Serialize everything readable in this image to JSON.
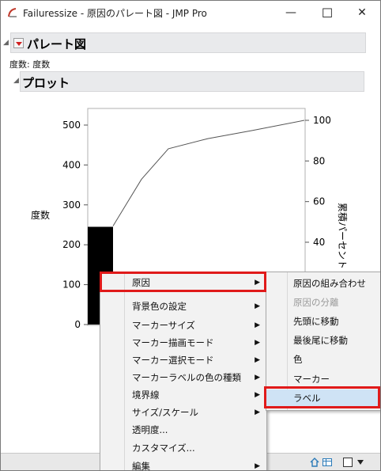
{
  "window": {
    "title": "Failuressize - 原因のパレート図 - JMP Pro",
    "minimize_glyph": "—",
    "maximize_glyph": "☐",
    "close_glyph": "✕"
  },
  "report": {
    "pareto_header": "パレート図",
    "freq_label": "度数: 度数",
    "plot_header": "プロット",
    "left_axis_title": "度数",
    "right_axis_title": "累積パーセント"
  },
  "chart_data": {
    "type": "bar",
    "left_axis": {
      "ticks": [
        0,
        100,
        200,
        300,
        400,
        500
      ],
      "ylim": [
        0,
        550
      ]
    },
    "right_axis": {
      "ticks": [
        40,
        60,
        80,
        100
      ]
    },
    "bars": [
      {
        "value": 245
      }
    ],
    "cumulative_percent": [
      {
        "x": 0,
        "y": 48
      },
      {
        "x": 1,
        "y": 71
      },
      {
        "x": 2,
        "y": 86
      },
      {
        "x": 3,
        "y": 91
      },
      {
        "x": 4,
        "y": 95
      },
      {
        "x": 5,
        "y": 100
      }
    ]
  },
  "context_menu": {
    "items": [
      {
        "label": "原因",
        "has_submenu": true
      },
      {
        "label": "背景色の設定",
        "has_submenu": true
      },
      {
        "label": "マーカーサイズ",
        "has_submenu": true
      },
      {
        "label": "マーカー描画モード",
        "has_submenu": true
      },
      {
        "label": "マーカー選択モード",
        "has_submenu": true
      },
      {
        "label": "マーカーラベルの色の種類",
        "has_submenu": true
      },
      {
        "label": "境界線",
        "has_submenu": true
      },
      {
        "label": "サイズ/スケール",
        "has_submenu": true
      },
      {
        "label": "透明度...",
        "has_submenu": false
      },
      {
        "label": "カスタマイズ...",
        "has_submenu": false
      },
      {
        "label": "編集",
        "has_submenu": true
      }
    ],
    "submenu_arrow": "▶"
  },
  "submenu": {
    "items": [
      {
        "label": "原因の組み合わせ",
        "disabled": false
      },
      {
        "label": "原因の分離",
        "disabled": true
      },
      {
        "label": "先頭に移動",
        "disabled": false
      },
      {
        "label": "最後尾に移動",
        "disabled": false
      },
      {
        "label": "色",
        "disabled": false
      },
      {
        "label": "マーカー",
        "disabled": false
      },
      {
        "label": "ラベル",
        "disabled": false
      }
    ]
  },
  "colors": {
    "highlight": "#e01a1a",
    "bar": "#000000",
    "selected_bg": "#cfe3f5"
  }
}
